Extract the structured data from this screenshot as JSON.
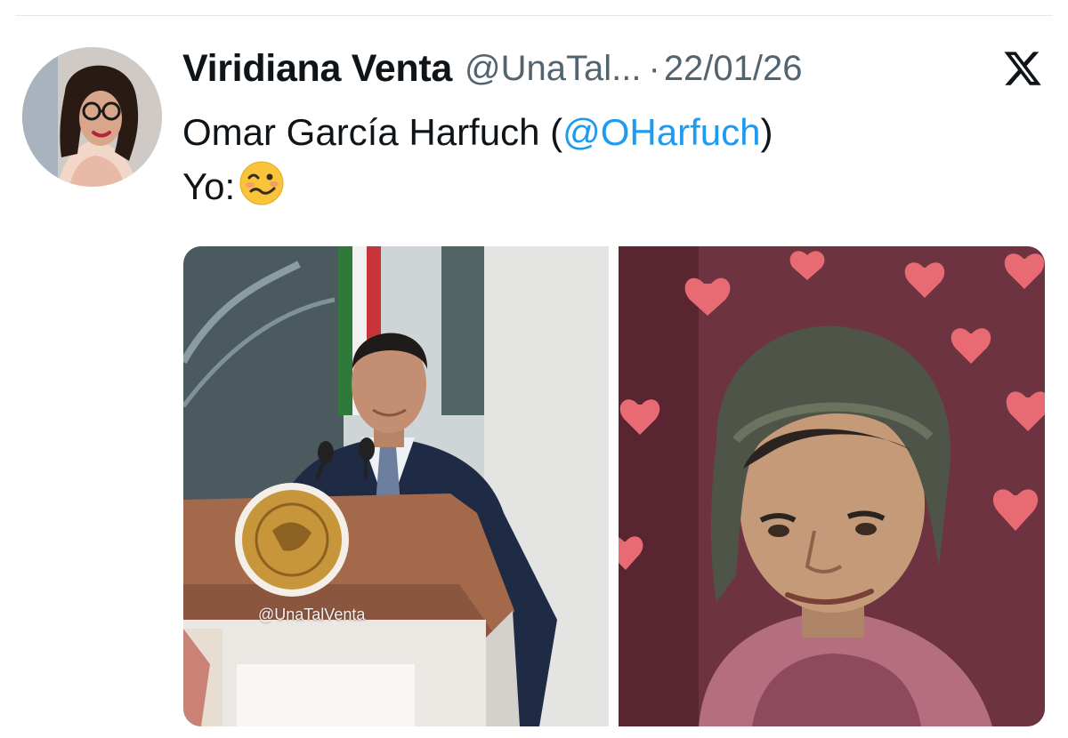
{
  "tweet": {
    "display_name": "Viridiana Venta",
    "handle": "@UnaTal...",
    "separator": "·",
    "date": "22/01/26",
    "text_line1_prefix": "Omar García Harfuch (",
    "mention": "@OHarfuch",
    "text_line1_suffix": ")",
    "text_line2": "Yo:",
    "emoji": "woozy-face-icon"
  },
  "media": {
    "left_watermark": "@UnaTalVenta"
  },
  "colors": {
    "text": "#0f1419",
    "secondary": "#536471",
    "link": "#1d9bf0"
  }
}
